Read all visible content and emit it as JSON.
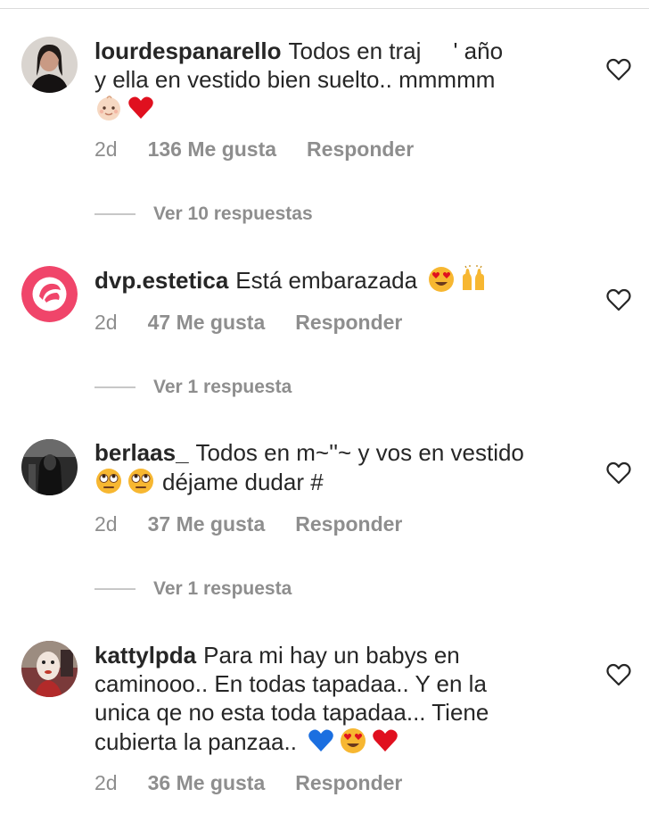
{
  "comments": [
    {
      "username": "lourdespanarello",
      "text_line1": "Todos en traj     ' año",
      "text_line2": "y ella en vestido bien suelto.. mmmmm",
      "emojis_after": [
        "baby-face-emoji",
        "red-heart-emoji"
      ],
      "time": "2d",
      "likes": "136 Me gusta",
      "reply_label": "Responder",
      "view_replies": "Ver 10 respuestas"
    },
    {
      "username": "dvp.estetica",
      "text": "Está embarazada",
      "emojis_after": [
        "heart-eyes-emoji",
        "raising-hands-emoji"
      ],
      "time": "2d",
      "likes": "47 Me gusta",
      "reply_label": "Responder",
      "view_replies": "Ver 1 respuesta"
    },
    {
      "username": "berlaas_",
      "text_line1": "Todos en m~''~ y vos en vestido",
      "text_line2": "déjame dudar #",
      "emojis_before_line2": [
        "rolling-eyes-emoji",
        "rolling-eyes-emoji"
      ],
      "time": "2d",
      "likes": "37 Me gusta",
      "reply_label": "Responder",
      "view_replies": "Ver 1 respuesta"
    },
    {
      "username": "kattylpda",
      "text_line1": "Para mi hay un babys en",
      "text_line2": "caminooo.. En todas tapadaa.. Y en la",
      "text_line3": "unica qe no esta toda tapadaa... Tiene",
      "text_line4": "cubierta la panzaa..",
      "emojis_after": [
        "blue-heart-emoji",
        "heart-eyes-emoji",
        "red-heart-emoji"
      ],
      "time": "2d",
      "likes": "36 Me gusta",
      "reply_label": "Responder"
    }
  ],
  "colors": {
    "text": "#262626",
    "muted": "#8e8e8e",
    "divider": "#dbdbdb",
    "dvp_brand": "#f0456a"
  }
}
